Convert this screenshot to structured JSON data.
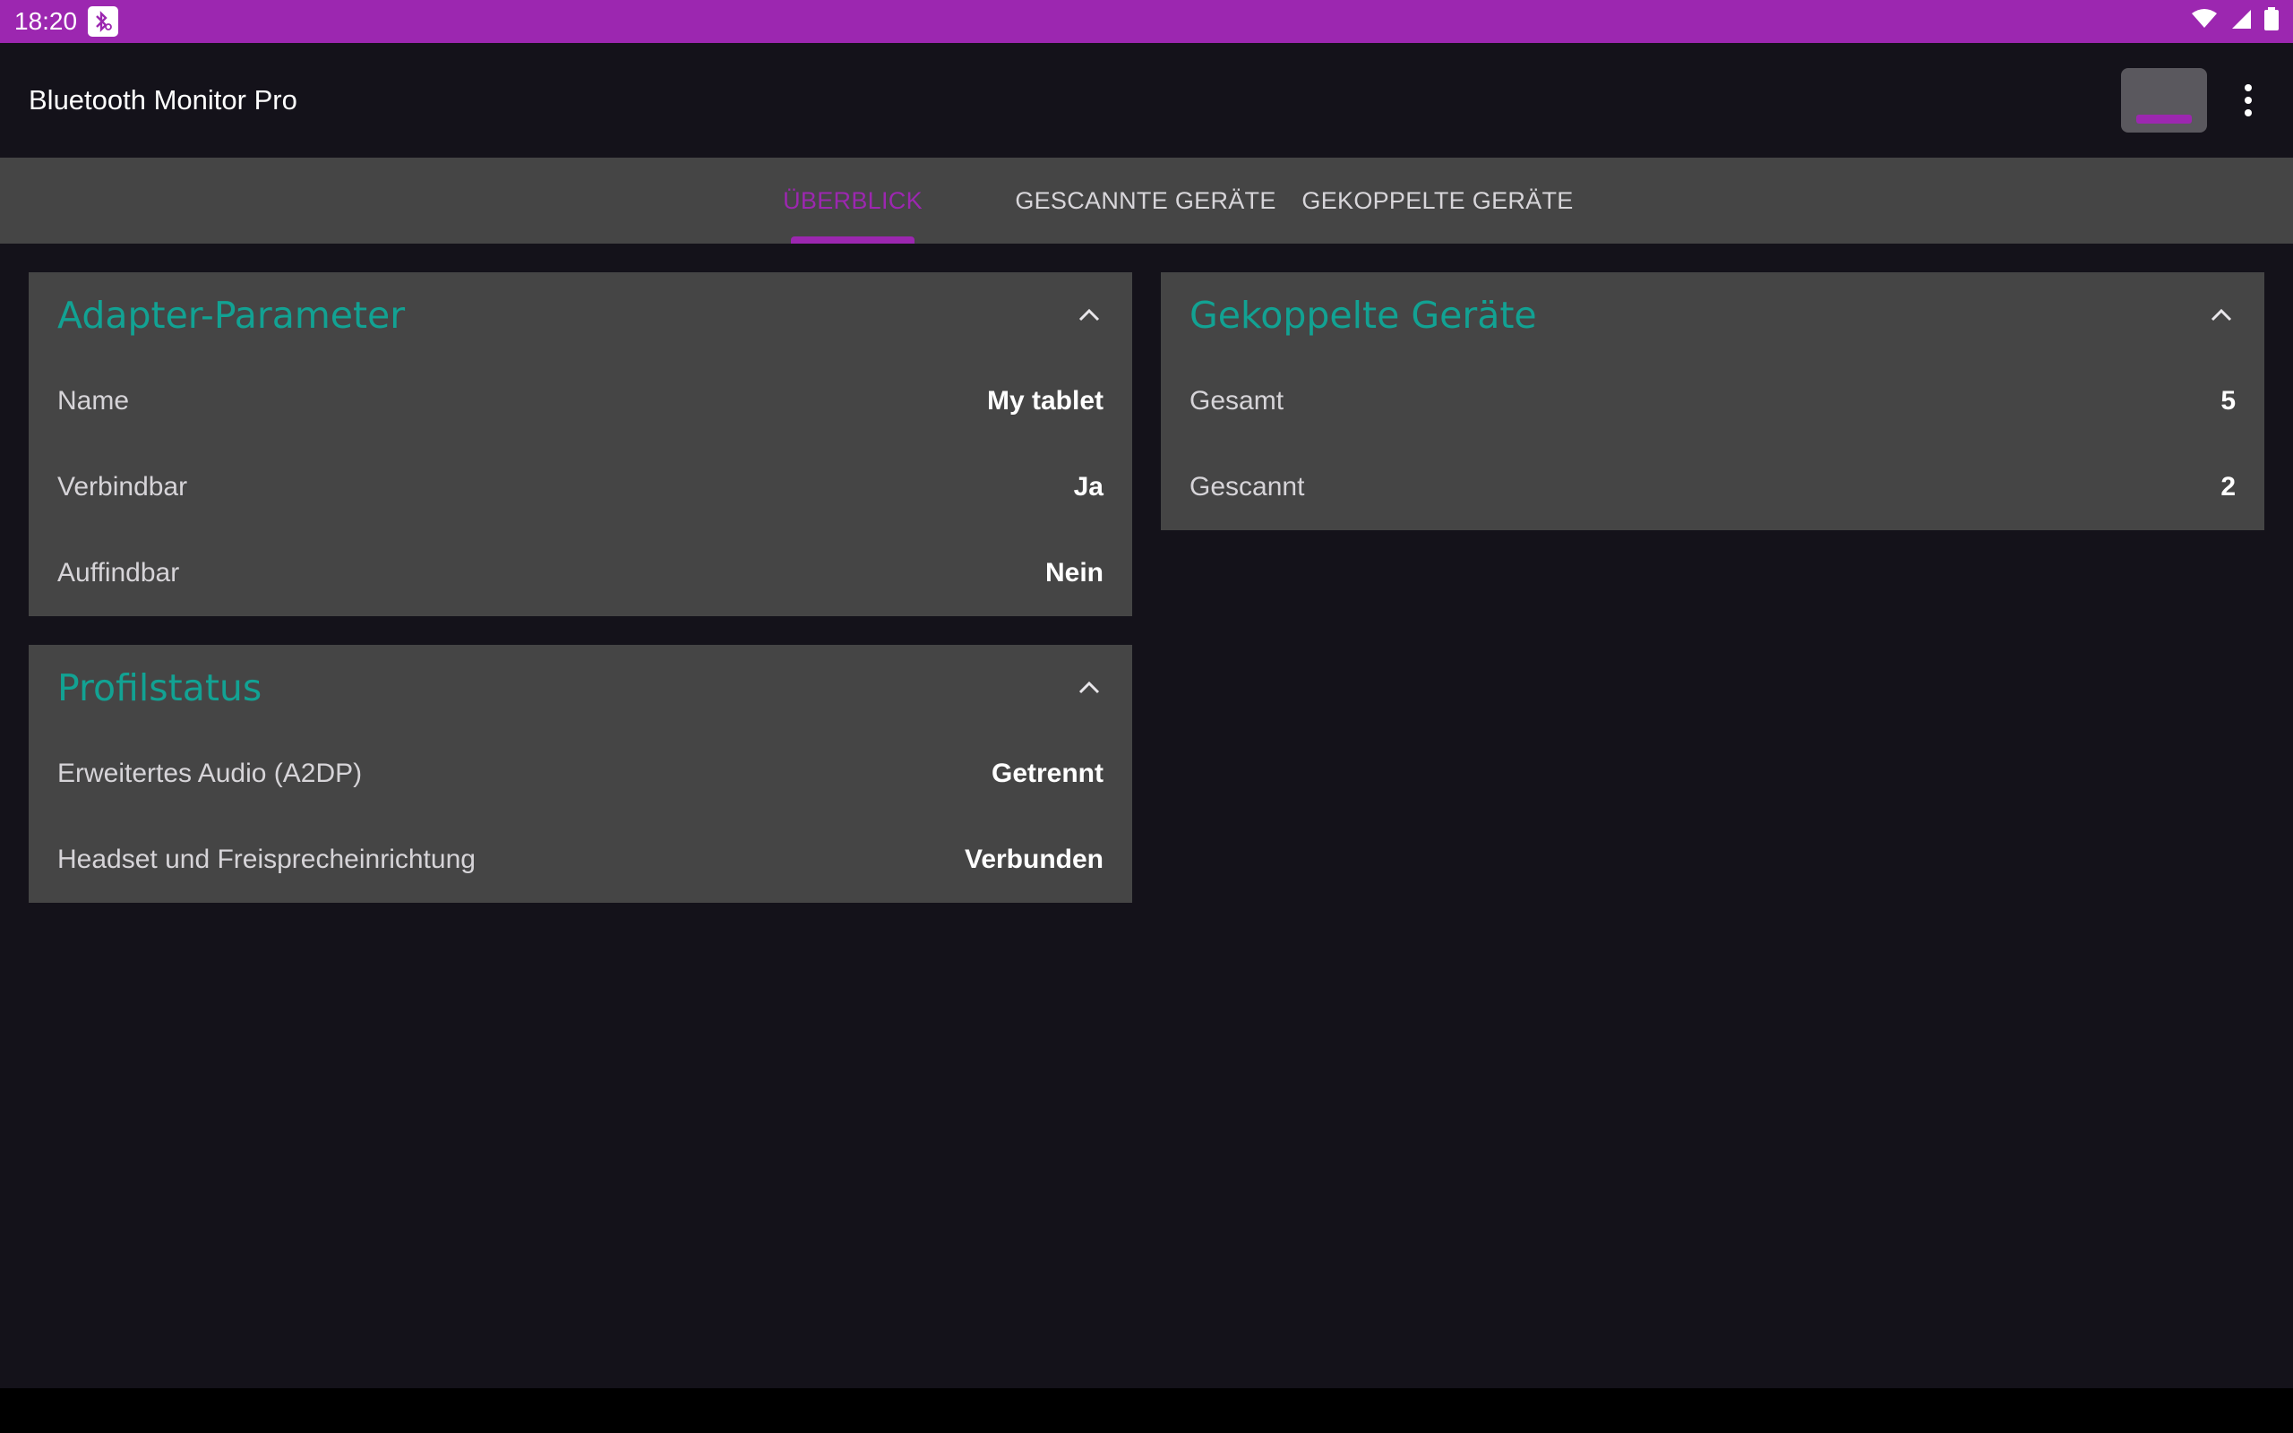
{
  "status_bar": {
    "time": "18:20",
    "icons": [
      "bluetooth-scan-notification-icon",
      "wifi-icon",
      "cell-signal-icon",
      "battery-icon"
    ]
  },
  "app_bar": {
    "title": "Bluetooth Monitor Pro",
    "action_icon": "toggle-action-icon",
    "menu_icon": "more-vert-icon"
  },
  "tabs": [
    {
      "label": "ÜBERBLICK",
      "active": true
    },
    {
      "label": "GESCANNTE GERÄTE",
      "active": false
    },
    {
      "label": "GEKOPPELTE GERÄTE",
      "active": false
    }
  ],
  "adapter_card": {
    "title": "Adapter-Parameter",
    "rows": [
      {
        "label": "Name",
        "value": "My tablet"
      },
      {
        "label": "Verbindbar",
        "value": "Ja"
      },
      {
        "label": "Auffindbar",
        "value": "Nein"
      }
    ]
  },
  "profile_card": {
    "title": "Profilstatus",
    "rows": [
      {
        "label": "Erweitertes Audio (A2DP)",
        "value": "Getrennt"
      },
      {
        "label": "Headset und Freisprecheinrichtung",
        "value": "Verbunden"
      }
    ]
  },
  "paired_card": {
    "title": "Gekoppelte Geräte",
    "rows": [
      {
        "label": "Gesamt",
        "value": "5"
      },
      {
        "label": "Gescannt",
        "value": "2"
      }
    ]
  },
  "colors": {
    "accent": "#9c27b0",
    "card_title": "#12a293",
    "card_bg": "#454545",
    "background": "#14121a"
  }
}
